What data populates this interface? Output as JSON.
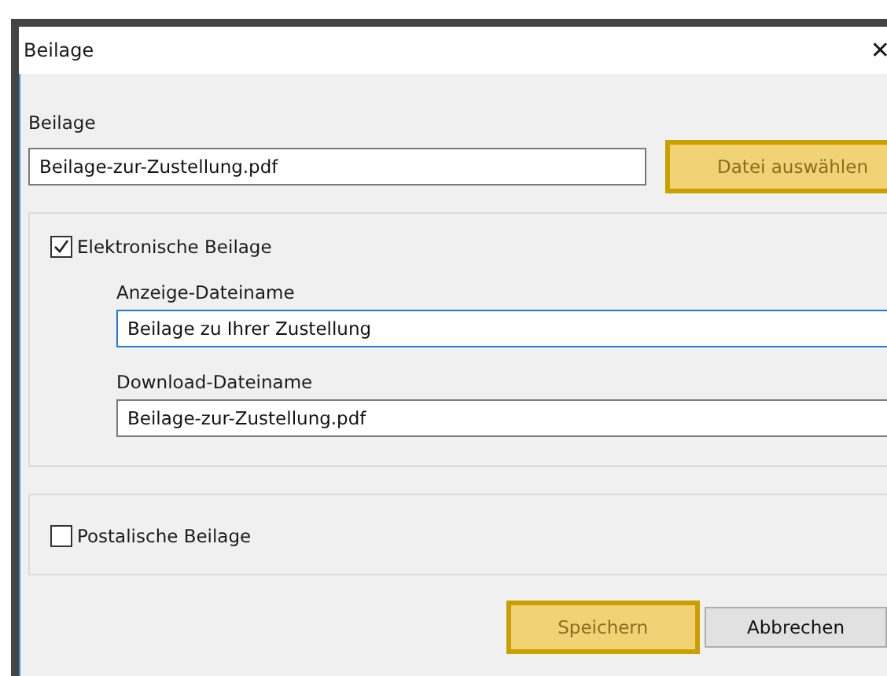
{
  "window": {
    "title": "Beilage",
    "close": "✕"
  },
  "file": {
    "label": "Beilage",
    "value": "Beilage-zur-Zustellung.pdf",
    "button": {
      "label": "Datei auswählen",
      "highlighted": true
    }
  },
  "electronic": {
    "label": "Elektronische Beilage",
    "checked": true,
    "fields": [
      {
        "label": "Anzeige-Dateiname",
        "value": "Beilage zu Ihrer Zustellung",
        "focused": true
      },
      {
        "label": "Download-Dateiname",
        "value": "Beilage-zur-Zustellung.pdf",
        "focused": false
      }
    ]
  },
  "postal": {
    "label": "Postalische Beilage",
    "checked": false
  },
  "buttons": [
    {
      "label": "Speichern",
      "highlighted": true
    },
    {
      "label": "Abbrechen",
      "highlighted": false
    }
  ]
}
